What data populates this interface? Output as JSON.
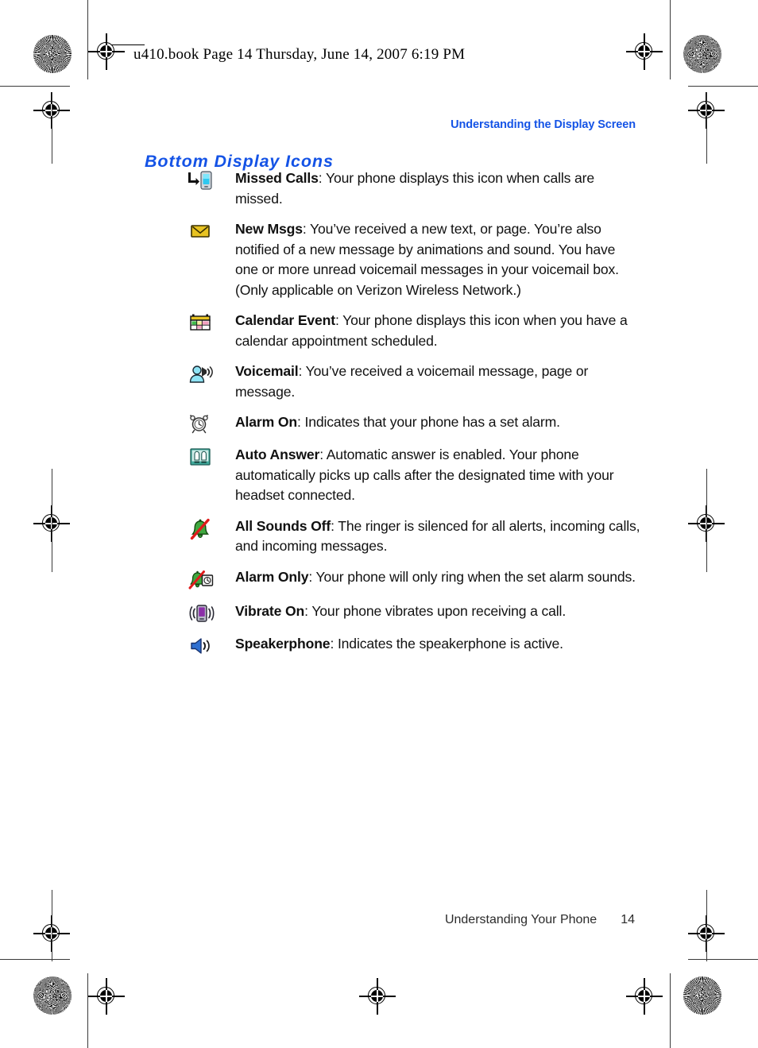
{
  "page": {
    "slug": "u410.book  Page 14  Thursday, June 14, 2007  6:19 PM",
    "running_head": "Understanding the Display Screen",
    "section_title": "Bottom Display Icons",
    "footer_chapter": "Understanding Your Phone",
    "footer_page_number": "14",
    "accent_color": "#1453e6"
  },
  "icons": [
    {
      "icon": "missed-calls-icon",
      "term": "Missed Calls",
      "separator": ": ",
      "description": "Your phone displays this icon when calls are missed."
    },
    {
      "icon": "new-message-envelope-icon",
      "term": "New Msgs",
      "separator": ": ",
      "description": "You’ve received a new text, or page. You’re also notified of a new message by animations and sound. You have one or more unread voicemail messages in your voicemail box. (Only applicable on Verizon Wireless Network.)"
    },
    {
      "icon": "calendar-event-icon",
      "term": "Calendar Event",
      "separator": ": ",
      "description": "Your phone displays this icon when you have a calendar appointment scheduled."
    },
    {
      "icon": "voicemail-icon",
      "term": "Voicemail",
      "separator": ": ",
      "description": "You’ve received a voicemail message, page or message."
    },
    {
      "icon": "alarm-on-icon",
      "term": "Alarm On",
      "separator": ": ",
      "description": "Indicates that your phone has a set alarm."
    },
    {
      "icon": "auto-answer-icon",
      "term": "Auto Answer",
      "separator": ": ",
      "description": "Automatic answer is enabled. Your phone automatically picks up calls after the designated time with your headset connected."
    },
    {
      "icon": "all-sounds-off-icon",
      "term": "All Sounds Off",
      "separator": ": ",
      "description": "The ringer is silenced for all alerts, incoming calls, and incoming messages."
    },
    {
      "icon": "alarm-only-icon",
      "term": "Alarm Only",
      "separator": ": ",
      "description": "Your phone will only ring when the set alarm sounds."
    },
    {
      "icon": "vibrate-on-icon",
      "term": "Vibrate On",
      "separator": ": ",
      "description": "Your phone vibrates upon receiving a call."
    },
    {
      "icon": "speakerphone-icon",
      "term": "Speakerphone",
      "separator": ": ",
      "description": "Indicates the speakerphone is active."
    }
  ]
}
